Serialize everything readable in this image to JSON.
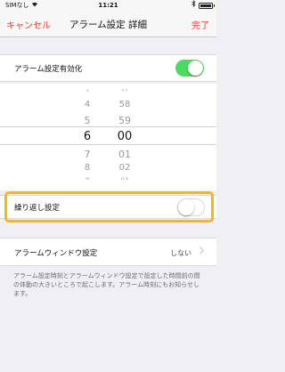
{
  "status_bar": {
    "carrier": "SIMなし",
    "time": "11:21"
  },
  "nav": {
    "cancel_label": "キャンセル",
    "title": "アラーム設定 詳細",
    "done_label": "完了"
  },
  "alarm_enabled": {
    "label": "アラーム設定有効化",
    "on": true
  },
  "time_picker": {
    "hours": [
      "3",
      "4",
      "5",
      "6",
      "7",
      "8",
      "9"
    ],
    "minutes": [
      "57",
      "58",
      "59",
      "00",
      "01",
      "02",
      "03"
    ],
    "selected_hour": "6",
    "selected_minute": "00"
  },
  "repeat": {
    "label": "繰り返し設定",
    "on": false
  },
  "alarm_window": {
    "label": "アラームウィンドウ設定",
    "value": "しない"
  },
  "footnote": "アラーム設定時刻とアラームウィンドウ設定で設定した時間前の間の体動の大きいところで起こします。アラーム時刻にもお知らせします。",
  "colors": {
    "accent": "#ff3b30",
    "toggle_on": "#4cd964",
    "highlight": "#f6b90f"
  }
}
